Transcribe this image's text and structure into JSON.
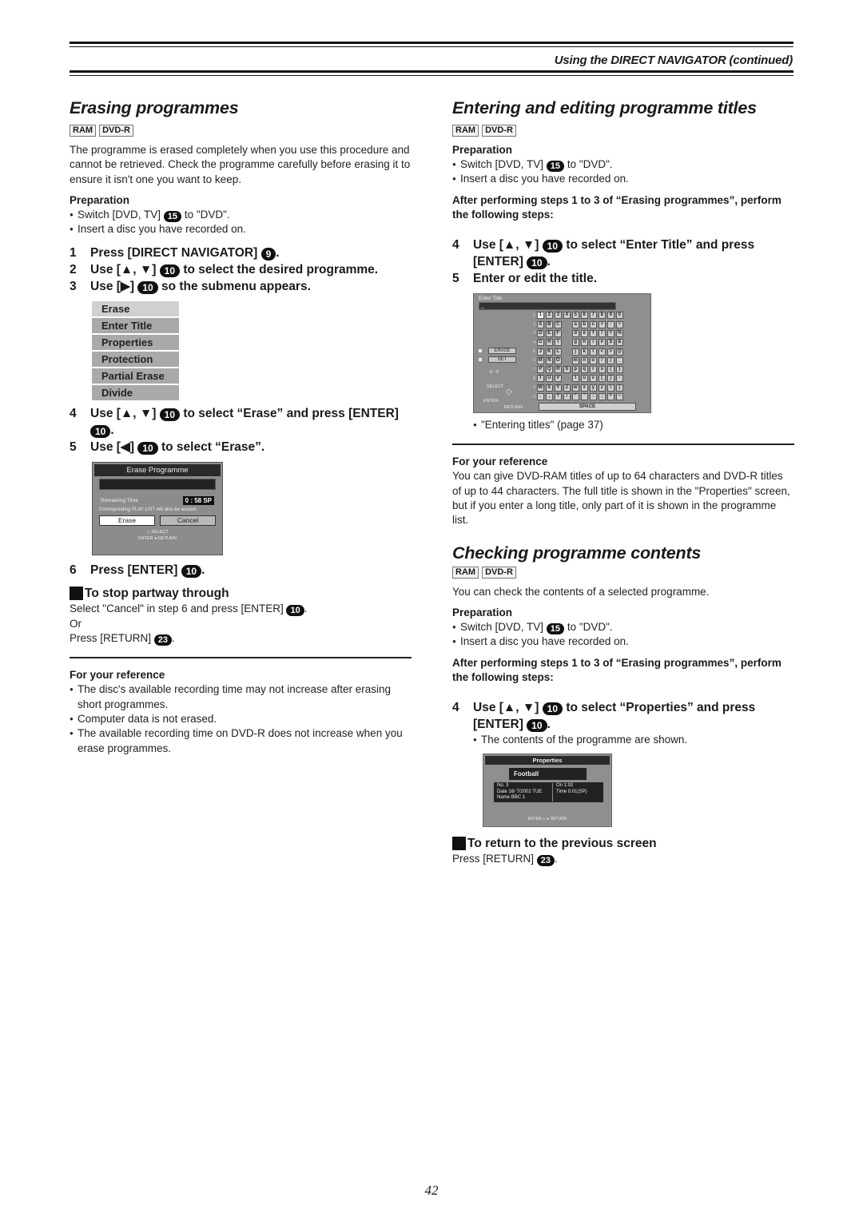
{
  "header": {
    "running_title": "Using the DIRECT NAVIGATOR (continued)"
  },
  "erasing": {
    "title": "Erasing programmes",
    "badges": [
      "RAM",
      "DVD-R"
    ],
    "intro": "The programme is erased completely when you use this procedure and cannot be retrieved. Check the programme carefully before erasing it to ensure it isn't one you want to keep.",
    "preparation_label": "Preparation",
    "prep": {
      "switch_a": "Switch [DVD, TV]",
      "key15": "15",
      "switch_b": "to \"DVD\".",
      "insert": "Insert a disc you have recorded on."
    },
    "steps": {
      "s1": {
        "num": "1",
        "a": "Press [DIRECT NAVIGATOR]",
        "key": "9",
        "b": "."
      },
      "s2": {
        "num": "2",
        "a": "Use [▲, ▼]",
        "key": "10",
        "b": "to select the desired programme."
      },
      "s3": {
        "num": "3",
        "a": "Use [▶]",
        "key": "10",
        "b": "so the submenu appears."
      },
      "s4": {
        "num": "4",
        "a": "Use [▲, ▼]",
        "key": "10",
        "b": "to select “Erase” and press [ENTER]",
        "key2": "10",
        "c": "."
      },
      "s5": {
        "num": "5",
        "a": "Use [◀]",
        "key": "10",
        "b": "to select “Erase”."
      },
      "s6": {
        "num": "6",
        "a": "Press [ENTER]",
        "key": "10",
        "b": "."
      }
    },
    "submenu": [
      "Erase",
      "Enter Title",
      "Properties",
      "Protection",
      "Partial Erase",
      "Divide"
    ],
    "erase_dialog": {
      "title": "Erase Programme",
      "remaining_label": "Remaining Time",
      "remaining_value": "0 : 58 SP",
      "warning": "Corresponding PLAY LIST will also be erased.",
      "erase_btn": "Erase",
      "cancel_btn": "Cancel",
      "nav_select": "SELECT",
      "nav_enter": "ENTER",
      "nav_return": "RETURN"
    },
    "stop": {
      "heading": "To stop partway through",
      "line1_a": "Select \"Cancel\" in step 6 and press [ENTER]",
      "line1_key": "10",
      "or": "Or",
      "line2_a": "Press [RETURN]",
      "line2_key": "23"
    },
    "reference": {
      "heading": "For your reference",
      "items": [
        "The disc's available recording time may not increase after erasing short programmes.",
        "Computer data is not erased.",
        "The available recording time on DVD-R does not increase when you erase programmes."
      ]
    }
  },
  "titles": {
    "title": "Entering and editing programme titles",
    "badges": [
      "RAM",
      "DVD-R"
    ],
    "preparation_label": "Preparation",
    "prep": {
      "switch_a": "Switch [DVD, TV]",
      "key15": "15",
      "switch_b": "to \"DVD\".",
      "insert": "Insert a disc you have recorded on."
    },
    "after_note": "After performing steps 1 to 3 of “Erasing programmes”, perform the following steps:",
    "steps": {
      "s4": {
        "num": "4",
        "a": "Use [▲, ▼]",
        "key": "10",
        "b": "to select “Enter Title” and press [ENTER]",
        "key2": "10",
        "c": "."
      },
      "s5": {
        "num": "5",
        "a": "Enter or edit the title."
      }
    },
    "screen": {
      "title": "Enter Title",
      "cursor": "_",
      "erase_btn": "ERASE",
      "set_btn": "SET",
      "digits_hint": "0 - 9",
      "nav_select": "SELECT",
      "nav_enter": "ENTER",
      "nav_return": "RETURN",
      "space": "SPACE",
      "rows": [
        {
          "n": "1",
          "keys": [
            "1",
            "2",
            "3",
            "4",
            "5",
            "6",
            "7",
            "8",
            "9",
            "0"
          ]
        },
        {
          "n": "2",
          "keys": [
            "A",
            "B",
            "C",
            "",
            "a",
            "b",
            "c",
            "+",
            "-",
            "÷"
          ]
        },
        {
          "n": "3",
          "keys": [
            "D",
            "E",
            "F",
            "",
            "d",
            "e",
            "f",
            "/",
            "=",
            "%"
          ]
        },
        {
          "n": "4",
          "keys": [
            "G",
            "H",
            "I",
            "",
            "g",
            "h",
            "i",
            "#",
            "$",
            "&"
          ]
        },
        {
          "n": "5",
          "keys": [
            "J",
            "K",
            "L",
            "",
            "j",
            "k",
            "l",
            "<",
            ">",
            "@"
          ]
        },
        {
          "n": "6",
          "keys": [
            "M",
            "N",
            "O",
            "",
            "m",
            "n",
            "o",
            "!",
            "|",
            "_"
          ]
        },
        {
          "n": "7",
          "keys": [
            "P",
            "Q",
            "R",
            "S",
            "p",
            "q",
            "r",
            "s",
            "(",
            ")"
          ]
        },
        {
          "n": "8",
          "keys": [
            "T",
            "U",
            "V",
            "",
            "t",
            "u",
            "v",
            "[",
            "]",
            "-"
          ]
        },
        {
          "n": "9",
          "keys": [
            "W",
            "X",
            "Y",
            "Z",
            "w",
            "x",
            "y",
            "z",
            "\\",
            "|"
          ]
        },
        {
          "n": "0",
          "keys": [
            ".",
            ",",
            "?",
            "!",
            "\"",
            "'",
            ":",
            ";",
            "^",
            "~"
          ]
        }
      ]
    },
    "see_also": "\"Entering titles\" (page 37)",
    "reference": {
      "heading": "For your reference",
      "text": "You can give DVD-RAM titles of up to 64 characters and DVD-R titles of up to 44 characters. The full title is shown in the \"Properties\" screen, but if you enter a long title, only part of it is shown in the programme list."
    }
  },
  "checking": {
    "title": "Checking programme contents",
    "badges": [
      "RAM",
      "DVD-R"
    ],
    "intro": "You can check the contents of a selected programme.",
    "preparation_label": "Preparation",
    "prep": {
      "switch_a": "Switch [DVD, TV]",
      "key15": "15",
      "switch_b": "to \"DVD\".",
      "insert": "Insert a disc you have recorded on."
    },
    "after_note": "After performing steps 1 to 3 of “Erasing programmes”, perform the following steps:",
    "steps": {
      "s4": {
        "num": "4",
        "a": "Use [▲, ▼]",
        "key": "10",
        "b": "to select “Properties” and press [ENTER]",
        "key2": "10",
        "c": "."
      }
    },
    "step_note": "The contents of the programme are shown.",
    "screen": {
      "title": "Properties",
      "name": "Football",
      "no_label": "No.",
      "no_value": "3",
      "date_label": "Date",
      "date_value": "16/ 7/2002 TUE",
      "name_label": "Name",
      "name_value": "BBC 1",
      "on_label": "On",
      "on_value": "1:02",
      "time_label": "Time",
      "time_value": "0:01(SP)",
      "nav_enter": "ENTER",
      "nav_return": "RETURN"
    },
    "return": {
      "heading": "To return to the previous screen",
      "line_a": "Press [RETURN]",
      "line_key": "23"
    }
  },
  "page_number": "42"
}
